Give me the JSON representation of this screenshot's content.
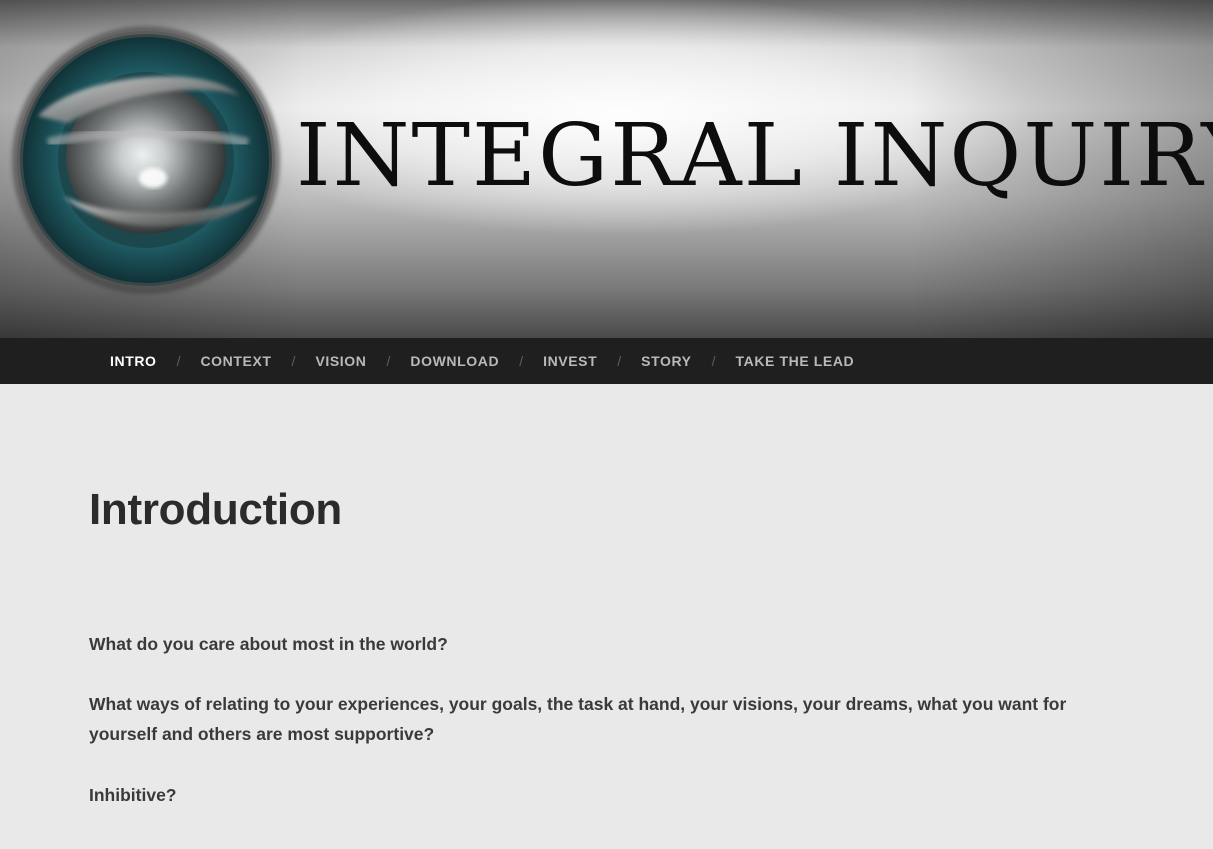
{
  "header": {
    "logo_text": "INTEGRAL INQUIRY",
    "emblem_icon": "integral-sphere-icon",
    "colors": {
      "emblem_ring": "#1f5a63",
      "emblem_inner": "#2d6f78"
    }
  },
  "nav": {
    "items": [
      {
        "label": "INTRO",
        "active": true
      },
      {
        "label": "CONTEXT",
        "active": false
      },
      {
        "label": "VISION",
        "active": false
      },
      {
        "label": "DOWNLOAD",
        "active": false
      },
      {
        "label": "INVEST",
        "active": false
      },
      {
        "label": "STORY",
        "active": false
      },
      {
        "label": "TAKE THE LEAD",
        "active": false
      }
    ],
    "separator": "/",
    "colors": {
      "background": "#1f1f1f",
      "active": "#ffffff",
      "inactive": "#b9b9b9"
    }
  },
  "main": {
    "title": "Introduction",
    "paragraphs": [
      "What do you care about most in the world?",
      "What ways of relating to your experiences, your goals, the task at hand, your visions, your dreams, what you want for yourself and others are most supportive?",
      "Inhibitive?"
    ]
  }
}
